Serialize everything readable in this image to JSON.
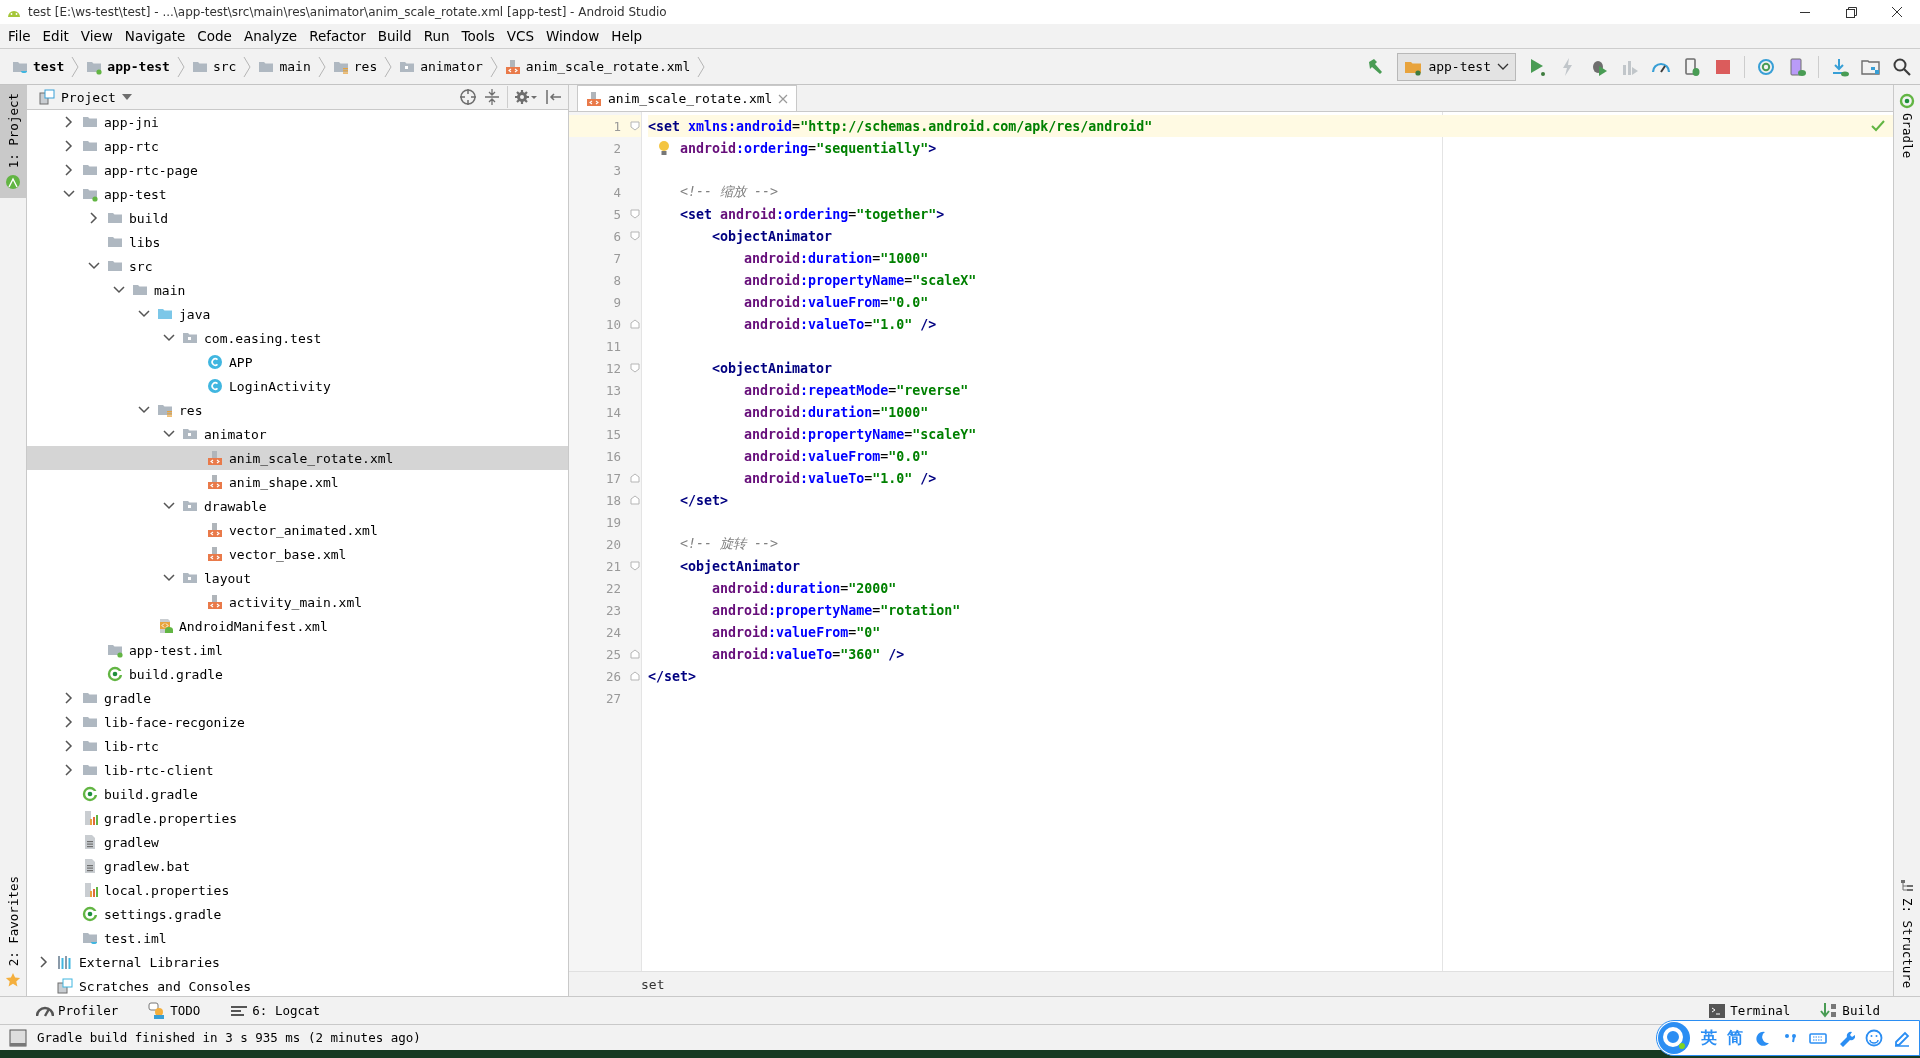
{
  "window": {
    "title": "test [E:\\ws-test\\test] - ...\\app-test\\src\\main\\res\\animator\\anim_scale_rotate.xml [app-test] - Android Studio"
  },
  "menu": [
    "File",
    "Edit",
    "View",
    "Navigate",
    "Code",
    "Analyze",
    "Refactor",
    "Build",
    "Run",
    "Tools",
    "VCS",
    "Window",
    "Help"
  ],
  "breadcrumbs": [
    {
      "label": "test",
      "kind": "project",
      "bold": true
    },
    {
      "label": "app-test",
      "kind": "module",
      "bold": true
    },
    {
      "label": "src",
      "kind": "folder",
      "bold": false
    },
    {
      "label": "main",
      "kind": "folder",
      "bold": false
    },
    {
      "label": "res",
      "kind": "res",
      "bold": false
    },
    {
      "label": "animator",
      "kind": "package",
      "bold": false
    },
    {
      "label": "anim_scale_rotate.xml",
      "kind": "xml",
      "bold": false
    }
  ],
  "toolbar": {
    "config": "app-test",
    "buttons": [
      {
        "kind": "make",
        "disabled": false
      },
      {
        "kind": "run",
        "disabled": false
      },
      {
        "kind": "apply",
        "disabled": true
      },
      {
        "kind": "debug",
        "disabled": false
      },
      {
        "kind": "coverage",
        "disabled": true
      },
      {
        "kind": "profile",
        "disabled": false
      },
      {
        "kind": "attach",
        "disabled": false
      },
      {
        "kind": "stop",
        "disabled": false
      },
      {
        "kind": "sync",
        "disabled": false
      },
      {
        "kind": "avd",
        "disabled": false
      },
      {
        "kind": "sdk",
        "disabled": false
      },
      {
        "kind": "structure",
        "disabled": false
      },
      {
        "kind": "search",
        "disabled": false
      }
    ]
  },
  "left_stripe": {
    "top": {
      "label": "1: Project",
      "selected": true
    },
    "bottom": {
      "label": "2: Favorites",
      "selected": false
    }
  },
  "right_stripe": {
    "top": "Gradle",
    "bottom": "Z: Structure"
  },
  "project_panel": {
    "title": "Project",
    "tree": {
      "continued_children": [
        {
          "label": "app-jni",
          "kind": "folder",
          "expanded": false,
          "selected": false
        },
        {
          "label": "app-rtc",
          "kind": "folder",
          "expanded": false,
          "selected": false
        },
        {
          "label": "app-rtc-page",
          "kind": "folder",
          "expanded": false,
          "selected": false
        },
        {
          "label": "app-test",
          "kind": "module",
          "expanded": true,
          "selected": false,
          "children": [
            {
              "label": "build",
              "kind": "folder",
              "expanded": false,
              "selected": false
            },
            {
              "label": "libs",
              "kind": "folder",
              "selected": false
            },
            {
              "label": "src",
              "kind": "folder",
              "expanded": true,
              "selected": false,
              "children": [
                {
                  "label": "main",
                  "kind": "folder",
                  "expanded": true,
                  "selected": false,
                  "children": [
                    {
                      "label": "java",
                      "kind": "source",
                      "expanded": true,
                      "selected": false,
                      "children": [
                        {
                          "label": "com.easing.test",
                          "kind": "package",
                          "expanded": true,
                          "selected": false,
                          "children": [
                            {
                              "label": "APP",
                              "kind": "class",
                              "selected": false
                            },
                            {
                              "label": "LoginActivity",
                              "kind": "class",
                              "selected": false
                            }
                          ]
                        }
                      ]
                    },
                    {
                      "label": "res",
                      "kind": "res",
                      "expanded": true,
                      "selected": false,
                      "children": [
                        {
                          "label": "animator",
                          "kind": "package",
                          "expanded": true,
                          "selected": false,
                          "children": [
                            {
                              "label": "anim_scale_rotate.xml",
                              "kind": "xml",
                              "selected": true
                            },
                            {
                              "label": "anim_shape.xml",
                              "kind": "xml",
                              "selected": false
                            }
                          ]
                        },
                        {
                          "label": "drawable",
                          "kind": "package",
                          "expanded": true,
                          "selected": false,
                          "children": [
                            {
                              "label": "vector_animated.xml",
                              "kind": "xml",
                              "selected": false
                            },
                            {
                              "label": "vector_base.xml",
                              "kind": "xml",
                              "selected": false
                            }
                          ]
                        },
                        {
                          "label": "layout",
                          "kind": "package",
                          "expanded": true,
                          "selected": false,
                          "children": [
                            {
                              "label": "activity_main.xml",
                              "kind": "xml",
                              "selected": false
                            }
                          ]
                        }
                      ]
                    },
                    {
                      "label": "AndroidManifest.xml",
                      "kind": "manifest",
                      "selected": false
                    }
                  ]
                }
              ]
            },
            {
              "label": "app-test.iml",
              "kind": "iml",
              "selected": false
            },
            {
              "label": "build.gradle",
              "kind": "gradle",
              "selected": false
            }
          ]
        },
        {
          "label": "gradle",
          "kind": "folder",
          "expanded": false,
          "selected": false
        },
        {
          "label": "lib-face-recgonize",
          "kind": "folder",
          "expanded": false,
          "selected": false
        },
        {
          "label": "lib-rtc",
          "kind": "folder",
          "expanded": false,
          "selected": false
        },
        {
          "label": "lib-rtc-client",
          "kind": "folder",
          "expanded": false,
          "selected": false
        },
        {
          "label": "build.gradle",
          "kind": "gradle",
          "selected": false
        },
        {
          "label": "gradle.properties",
          "kind": "properties",
          "selected": false
        },
        {
          "label": "gradlew",
          "kind": "text",
          "selected": false
        },
        {
          "label": "gradlew.bat",
          "kind": "text",
          "selected": false
        },
        {
          "label": "local.properties",
          "kind": "properties",
          "selected": false
        },
        {
          "label": "settings.gradle",
          "kind": "gradle",
          "selected": false
        },
        {
          "label": "test.iml",
          "kind": "project-iml",
          "selected": false
        }
      ],
      "items": [
        {
          "label": "External Libraries",
          "kind": "libraries",
          "expanded": false,
          "selected": false
        },
        {
          "label": "Scratches and Consoles",
          "kind": "scratches",
          "selected": false
        }
      ]
    }
  },
  "editor": {
    "tabs": [
      {
        "label": "anim_scale_rotate.xml",
        "selected": true
      }
    ],
    "lines": [
      {
        "n": "1",
        "current": true,
        "kind": "fold-start",
        "tokens": [
          {
            "kind": "tag",
            "text": "<set"
          },
          {
            "kind": "attr",
            "text": " xmlns:android"
          },
          {
            "kind": "plain",
            "text": "="
          },
          {
            "kind": "value",
            "text": "\"http://schemas.android.com/apk/res/android\""
          }
        ]
      },
      {
        "n": "2",
        "current": false,
        "kind": "plain",
        "intention": true,
        "tokens": [
          {
            "kind": "ns",
            "text": "android"
          },
          {
            "kind": "attr",
            "text": ":ordering"
          },
          {
            "kind": "plain",
            "text": "="
          },
          {
            "kind": "value",
            "text": "\"sequentially\""
          },
          {
            "kind": "tag",
            "text": ">"
          }
        ]
      },
      {
        "n": "3",
        "current": false,
        "kind": "plain"
      },
      {
        "n": "4",
        "current": false,
        "kind": "plain",
        "tokens": [
          {
            "kind": "comment",
            "text": "    <!-- 缩放 -->"
          }
        ]
      },
      {
        "n": "5",
        "current": false,
        "kind": "fold-start",
        "tokens": [
          {
            "kind": "tag",
            "text": "    <set"
          },
          {
            "kind": "ns",
            "text": " android"
          },
          {
            "kind": "attr",
            "text": ":ordering"
          },
          {
            "kind": "plain",
            "text": "="
          },
          {
            "kind": "value",
            "text": "\"together\""
          },
          {
            "kind": "tag",
            "text": ">"
          }
        ]
      },
      {
        "n": "6",
        "current": false,
        "kind": "fold-start",
        "tokens": [
          {
            "kind": "tag",
            "text": "        <objectAnimator"
          }
        ]
      },
      {
        "n": "7",
        "current": false,
        "kind": "plain",
        "tokens": [
          {
            "kind": "ns",
            "text": "            android"
          },
          {
            "kind": "attr",
            "text": ":duration"
          },
          {
            "kind": "plain",
            "text": "="
          },
          {
            "kind": "value",
            "text": "\"1000\""
          }
        ]
      },
      {
        "n": "8",
        "current": false,
        "kind": "plain",
        "tokens": [
          {
            "kind": "ns",
            "text": "            android"
          },
          {
            "kind": "attr",
            "text": ":propertyName"
          },
          {
            "kind": "plain",
            "text": "="
          },
          {
            "kind": "value",
            "text": "\"scaleX\""
          }
        ]
      },
      {
        "n": "9",
        "current": false,
        "kind": "plain",
        "tokens": [
          {
            "kind": "ns",
            "text": "            android"
          },
          {
            "kind": "attr",
            "text": ":valueFrom"
          },
          {
            "kind": "plain",
            "text": "="
          },
          {
            "kind": "value",
            "text": "\"0.0\""
          }
        ]
      },
      {
        "n": "10",
        "current": false,
        "kind": "fold-end",
        "tokens": [
          {
            "kind": "ns",
            "text": "            android"
          },
          {
            "kind": "attr",
            "text": ":valueTo"
          },
          {
            "kind": "plain",
            "text": "="
          },
          {
            "kind": "value",
            "text": "\"1.0\""
          },
          {
            "kind": "tag",
            "text": " />"
          }
        ]
      },
      {
        "n": "11",
        "current": false,
        "kind": "plain"
      },
      {
        "n": "12",
        "current": false,
        "kind": "fold-start",
        "tokens": [
          {
            "kind": "tag",
            "text": "        <objectAnimator"
          }
        ]
      },
      {
        "n": "13",
        "current": false,
        "kind": "plain",
        "tokens": [
          {
            "kind": "ns",
            "text": "            android"
          },
          {
            "kind": "attr",
            "text": ":repeatMode"
          },
          {
            "kind": "plain",
            "text": "="
          },
          {
            "kind": "value",
            "text": "\"reverse\""
          }
        ]
      },
      {
        "n": "14",
        "current": false,
        "kind": "plain",
        "tokens": [
          {
            "kind": "ns",
            "text": "            android"
          },
          {
            "kind": "attr",
            "text": ":duration"
          },
          {
            "kind": "plain",
            "text": "="
          },
          {
            "kind": "value",
            "text": "\"1000\""
          }
        ]
      },
      {
        "n": "15",
        "current": false,
        "kind": "plain",
        "tokens": [
          {
            "kind": "ns",
            "text": "            android"
          },
          {
            "kind": "attr",
            "text": ":propertyName"
          },
          {
            "kind": "plain",
            "text": "="
          },
          {
            "kind": "value",
            "text": "\"scaleY\""
          }
        ]
      },
      {
        "n": "16",
        "current": false,
        "kind": "plain",
        "tokens": [
          {
            "kind": "ns",
            "text": "            android"
          },
          {
            "kind": "attr",
            "text": ":valueFrom"
          },
          {
            "kind": "plain",
            "text": "="
          },
          {
            "kind": "value",
            "text": "\"0.0\""
          }
        ]
      },
      {
        "n": "17",
        "current": false,
        "kind": "fold-end",
        "tokens": [
          {
            "kind": "ns",
            "text": "            android"
          },
          {
            "kind": "attr",
            "text": ":valueTo"
          },
          {
            "kind": "plain",
            "text": "="
          },
          {
            "kind": "value",
            "text": "\"1.0\""
          },
          {
            "kind": "tag",
            "text": " />"
          }
        ]
      },
      {
        "n": "18",
        "current": false,
        "kind": "fold-end",
        "tokens": [
          {
            "kind": "tag",
            "text": "    </set>"
          }
        ]
      },
      {
        "n": "19",
        "current": false,
        "kind": "plain"
      },
      {
        "n": "20",
        "current": false,
        "kind": "plain",
        "tokens": [
          {
            "kind": "comment",
            "text": "    <!-- 旋转 -->"
          }
        ]
      },
      {
        "n": "21",
        "current": false,
        "kind": "fold-start",
        "tokens": [
          {
            "kind": "tag",
            "text": "    <objectAnimator"
          }
        ]
      },
      {
        "n": "22",
        "current": false,
        "kind": "plain",
        "tokens": [
          {
            "kind": "ns",
            "text": "        android"
          },
          {
            "kind": "attr",
            "text": ":duration"
          },
          {
            "kind": "plain",
            "text": "="
          },
          {
            "kind": "value",
            "text": "\"2000\""
          }
        ]
      },
      {
        "n": "23",
        "current": false,
        "kind": "plain",
        "tokens": [
          {
            "kind": "ns",
            "text": "        android"
          },
          {
            "kind": "attr",
            "text": ":propertyName"
          },
          {
            "kind": "plain",
            "text": "="
          },
          {
            "kind": "value",
            "text": "\"rotation\""
          }
        ]
      },
      {
        "n": "24",
        "current": false,
        "kind": "plain",
        "tokens": [
          {
            "kind": "ns",
            "text": "        android"
          },
          {
            "kind": "attr",
            "text": ":valueFrom"
          },
          {
            "kind": "plain",
            "text": "="
          },
          {
            "kind": "value",
            "text": "\"0\""
          }
        ]
      },
      {
        "n": "25",
        "current": false,
        "kind": "fold-end",
        "tokens": [
          {
            "kind": "ns",
            "text": "        android"
          },
          {
            "kind": "attr",
            "text": ":valueTo"
          },
          {
            "kind": "plain",
            "text": "="
          },
          {
            "kind": "value",
            "text": "\"360\""
          },
          {
            "kind": "tag",
            "text": " />"
          }
        ]
      },
      {
        "n": "26",
        "current": false,
        "kind": "fold-end",
        "tokens": [
          {
            "kind": "tag",
            "text": "</set>"
          }
        ]
      },
      {
        "n": "27",
        "current": false,
        "kind": "plain"
      }
    ],
    "breadcrumb": "set"
  },
  "bottom_tools": {
    "left": [
      {
        "label": "Profiler",
        "kind": "profiler"
      },
      {
        "label": "TODO",
        "kind": "todo"
      },
      {
        "label": "6: Logcat",
        "kind": "logcat"
      }
    ],
    "right": [
      {
        "label": "Terminal",
        "kind": "terminal"
      },
      {
        "label": "Build",
        "kind": "build"
      }
    ]
  },
  "status_bar": {
    "message": "Gradle build finished in 3 s 935 ms (2 minutes ago)"
  },
  "ime_toolbar": {
    "labels": [
      "英",
      "简"
    ]
  }
}
